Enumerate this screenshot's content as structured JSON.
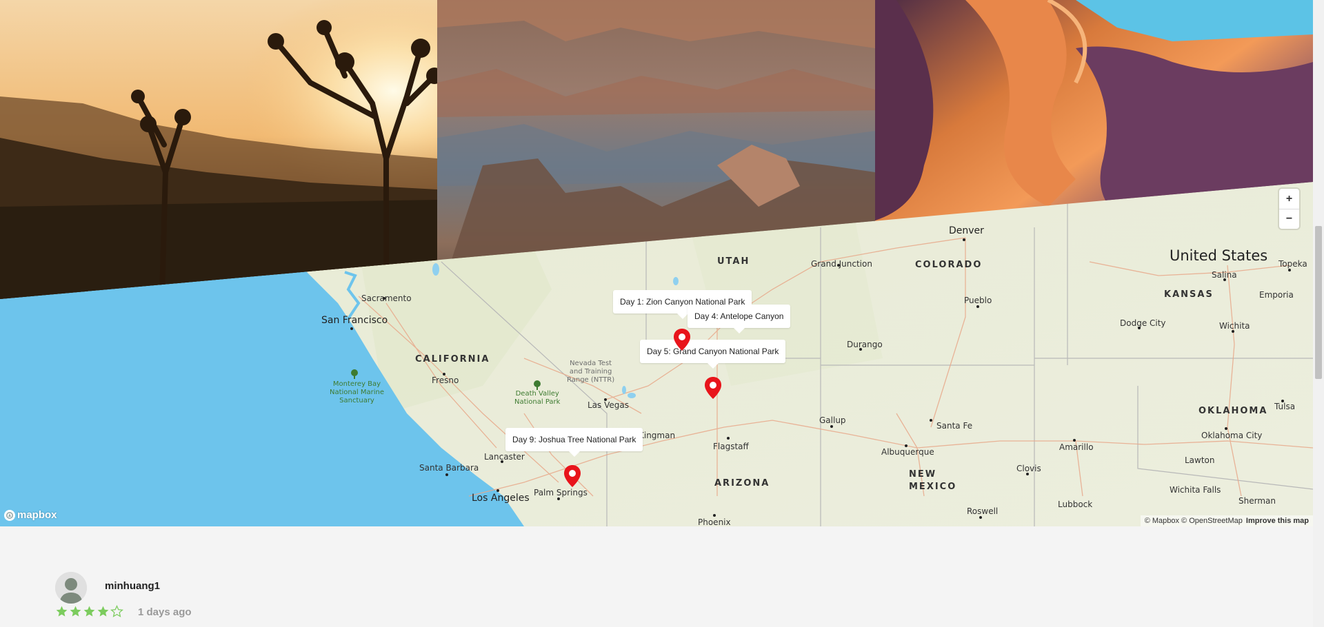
{
  "map": {
    "markers": [
      {
        "label": "Day 1: Zion Canyon National Park"
      },
      {
        "label": "Day 4: Antelope Canyon"
      },
      {
        "label": "Day 5: Grand Canyon National Park"
      },
      {
        "label": "Day 9: Joshua Tree National Park"
      }
    ],
    "labels": {
      "sacramento": "Sacramento",
      "san_francisco": "San Francisco",
      "california": "CALIFORNIA",
      "fresno": "Fresno",
      "monterey": "Monterey Bay\nNational Marine\nSanctuary",
      "death_valley": "Death Valley\nNational Park",
      "nevada_test": "Nevada Test\nand Training\nRange (NTTR)",
      "las_vegas": "Las Vegas",
      "utah": "UTAH",
      "grand_junction": "Grand Junction",
      "colorado": "COLORADO",
      "denver": "Denver",
      "pueblo": "Pueblo",
      "durango": "Durango",
      "united_states": "United States",
      "salina": "Salina",
      "topeka": "Topeka",
      "kansas": "KANSAS",
      "emporia": "Emporia",
      "dodge_city": "Dodge City",
      "wichita": "Wichita",
      "oklahoma": "OKLAHOMA",
      "tulsa": "Tulsa",
      "oklahoma_city": "Oklahoma City",
      "lawton": "Lawton",
      "wichita_falls": "Wichita Falls",
      "sherman": "Sherman",
      "lubbock": "Lubbock",
      "clovis": "Clovis",
      "amarillo": "Amarillo",
      "roswell": "Roswell",
      "new_mexico": "NEW\nMEXICO",
      "albuquerque": "Albuquerque",
      "santa_fe": "Santa Fe",
      "gallup": "Gallup",
      "flagstaff": "Flagstaff",
      "arizona": "ARIZONA",
      "phoenix": "Phoenix",
      "kingman": "Kingman",
      "lancaster": "Lancaster",
      "santa_barbara": "Santa Barbara",
      "los_angeles": "Los Angeles",
      "palm_springs": "Palm Springs"
    },
    "zoom_in": "+",
    "zoom_out": "−",
    "logo_text": "mapbox",
    "attribution": "© Mapbox © OpenStreetMap",
    "improve": "Improve this map"
  },
  "review": {
    "username": "minhuang1",
    "rating": 4,
    "max_rating": 5,
    "time_ago": "1 days ago"
  },
  "colors": {
    "water": "#6dc4ec",
    "land": "#e9ecd9",
    "pin": "#e8141b",
    "star": "#7ccc5e"
  }
}
